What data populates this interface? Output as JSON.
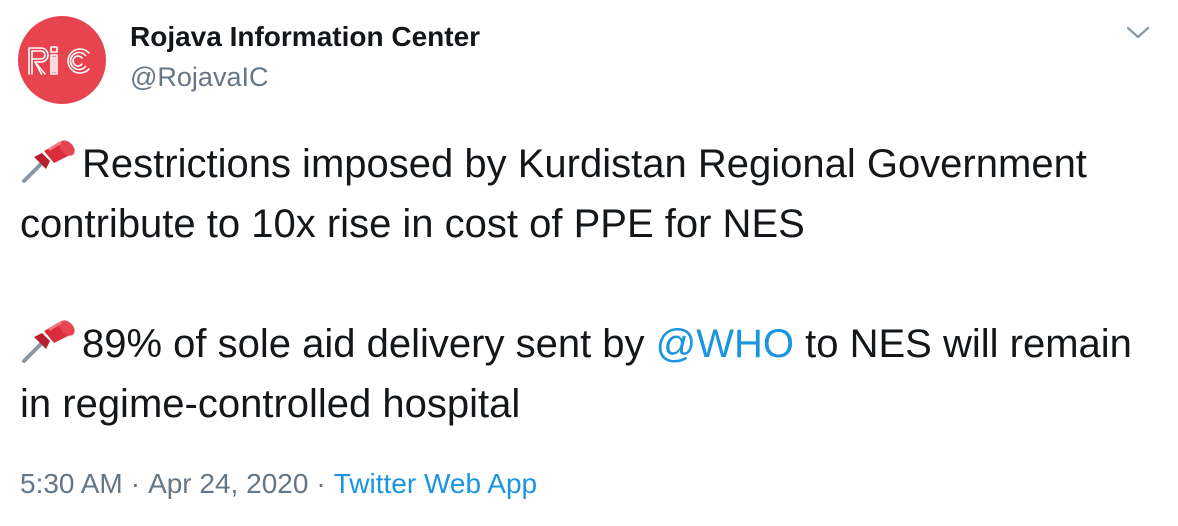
{
  "author": {
    "display_name": "Rojava Information Center",
    "handle": "@RojavaIC",
    "avatar_text": "RiC",
    "avatar_color": "#e8444f"
  },
  "tweet": {
    "paragraphs": [
      {
        "icon": "pushpin-icon",
        "text": "Restrictions imposed by Kurdistan Regional Government contribute to 10x rise in cost of PPE for NES"
      },
      {
        "icon": "pushpin-icon",
        "text_before": "89% of sole aid delivery sent by ",
        "mention": "@WHO",
        "text_after": " to NES will remain in regime-controlled hospital"
      }
    ]
  },
  "meta": {
    "time": "5:30 AM",
    "date": "Apr 24, 2020",
    "separator": "·",
    "source": "Twitter Web App"
  },
  "colors": {
    "link": "#1b95e0",
    "secondary_text": "#657786",
    "primary_text": "#14171a"
  },
  "menu_icon": "chevron-down-icon"
}
